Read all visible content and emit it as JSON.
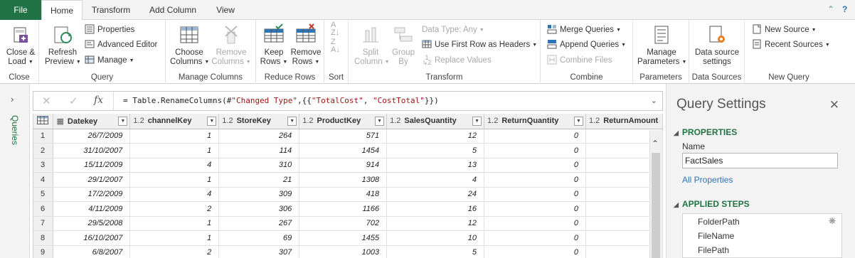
{
  "tabs": [
    "File",
    "Home",
    "Transform",
    "Add Column",
    "View"
  ],
  "ribbon": {
    "close": {
      "close_load": "Close &",
      "close_load2": "Load",
      "label": "Close"
    },
    "query": {
      "refresh": "Refresh",
      "refresh2": "Preview",
      "properties": "Properties",
      "advanced_editor": "Advanced Editor",
      "manage": "Manage",
      "label": "Query"
    },
    "manage_columns": {
      "choose": "Choose",
      "choose2": "Columns",
      "remove": "Remove",
      "remove2": "Columns",
      "label": "Manage Columns"
    },
    "reduce_rows": {
      "keep": "Keep",
      "keep2": "Rows",
      "remove": "Remove",
      "remove2": "Rows",
      "label": "Reduce Rows"
    },
    "sort": {
      "label": "Sort"
    },
    "transform": {
      "split": "Split",
      "split2": "Column",
      "group": "Group",
      "group2": "By",
      "data_type": "Data Type: Any",
      "first_row": "Use First Row as Headers",
      "replace": "Replace Values",
      "label": "Transform"
    },
    "combine": {
      "merge": "Merge Queries",
      "append": "Append Queries",
      "combine_files": "Combine Files",
      "label": "Combine"
    },
    "parameters": {
      "manage": "Manage",
      "manage2": "Parameters",
      "label": "Parameters"
    },
    "data_sources": {
      "settings": "Data source",
      "settings2": "settings",
      "label": "Data Sources"
    },
    "new_query": {
      "new_source": "New Source",
      "recent": "Recent Sources",
      "label": "New Query"
    }
  },
  "left_panel": {
    "label": "Queries"
  },
  "formula": {
    "prefix": "= Table.RenameColumns(#",
    "s1": "\"Changed Type\"",
    "mid": ",{{",
    "s2": "\"TotalCost\"",
    "comma": ", ",
    "s3": "\"CostTotal\"",
    "end": "}})"
  },
  "table": {
    "columns": [
      {
        "type": "",
        "name": "Datekey"
      },
      {
        "type": "1.2",
        "name": "channelKey"
      },
      {
        "type": "1.2",
        "name": "StoreKey"
      },
      {
        "type": "1.2",
        "name": "ProductKey"
      },
      {
        "type": "1.2",
        "name": "SalesQuantity"
      },
      {
        "type": "1.2",
        "name": "ReturnQuantity"
      },
      {
        "type": "1.2",
        "name": "ReturnAmount"
      }
    ],
    "rows": [
      [
        "1",
        "26/7/2009",
        "1",
        "264",
        "571",
        "12",
        "0"
      ],
      [
        "2",
        "31/10/2007",
        "1",
        "114",
        "1454",
        "5",
        "0"
      ],
      [
        "3",
        "15/11/2009",
        "4",
        "310",
        "914",
        "13",
        "0"
      ],
      [
        "4",
        "29/1/2007",
        "1",
        "21",
        "1308",
        "4",
        "0"
      ],
      [
        "5",
        "17/2/2009",
        "4",
        "309",
        "418",
        "24",
        "0"
      ],
      [
        "6",
        "4/11/2009",
        "2",
        "306",
        "1166",
        "16",
        "0"
      ],
      [
        "7",
        "29/5/2008",
        "1",
        "267",
        "702",
        "12",
        "0"
      ],
      [
        "8",
        "16/10/2007",
        "1",
        "69",
        "1455",
        "10",
        "0"
      ],
      [
        "9",
        "6/8/2007",
        "2",
        "307",
        "1003",
        "5",
        "0"
      ]
    ]
  },
  "query_settings": {
    "title": "Query Settings",
    "properties": "PROPERTIES",
    "name_label": "Name",
    "name_value": "FactSales",
    "all_properties": "All Properties",
    "applied_steps": "APPLIED STEPS",
    "steps": [
      "FolderPath",
      "FileName",
      "FilePath"
    ]
  },
  "colors": {
    "accent": "#217346",
    "link": "#2e75b6"
  }
}
